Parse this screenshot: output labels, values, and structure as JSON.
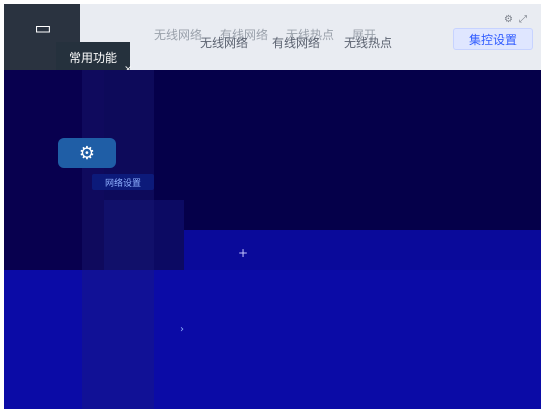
{
  "window": {
    "top_ghost_tabs": [
      "无线网络",
      "有线网络",
      "无线热点",
      "展开"
    ],
    "tabs": [
      "无线网络",
      "有线网络",
      "无线热点"
    ],
    "right_button": "集控设置",
    "mini_icons": [
      "settings-icon",
      "expand-icon"
    ]
  },
  "left_rail": {
    "edge_text": "功能"
  },
  "popover": {
    "title": "常用功能",
    "close": "×"
  },
  "main": {
    "chip_text": "网络设置",
    "mark": "+"
  }
}
